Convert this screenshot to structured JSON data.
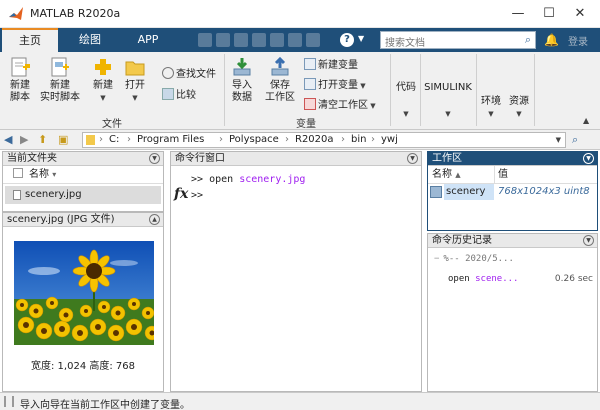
{
  "window": {
    "title": "MATLAB R2020a",
    "minimize": "—",
    "maximize": "☐",
    "close": "✕"
  },
  "tabs": [
    {
      "label": "主页"
    },
    {
      "label": "绘图"
    },
    {
      "label": "APP"
    }
  ],
  "search": {
    "placeholder": "搜索文档",
    "login": "登录"
  },
  "ribbon": {
    "file": {
      "new_script": [
        "新建",
        "脚本"
      ],
      "new_live_script": [
        "新建",
        "实时脚本"
      ],
      "new": "新建",
      "open": "打开",
      "find_files": "查找文件",
      "compare": "比较",
      "group_label": "文件"
    },
    "variable": {
      "import_data": [
        "导入",
        "数据"
      ],
      "save_workspace": [
        "保存",
        "工作区"
      ],
      "new_variable": "新建变量",
      "open_variable": "打开变量",
      "clear_workspace": "清空工作区",
      "group_label": "变量"
    },
    "code": "代码",
    "simulink": "SIMULINK",
    "environment": "环境",
    "resources": "资源"
  },
  "address": {
    "path": [
      "C:",
      "Program Files",
      "Polyspace",
      "R2020a",
      "bin",
      "ywj"
    ],
    "separator": "›"
  },
  "current_folder": {
    "title": "当前文件夹",
    "column_name": "名称",
    "sort_glyph": "▾",
    "files": [
      {
        "name": "scenery.jpg",
        "selected": true
      }
    ]
  },
  "details": {
    "title": "scenery.jpg  (JPG 文件)",
    "caption": "宽度: 1,024 高度: 768"
  },
  "command_window": {
    "title": "命令行窗口",
    "prompt": ">>",
    "command": "open",
    "argument": "scenery.jpg",
    "fx": "fx"
  },
  "workspace": {
    "title": "工作区",
    "col_name": "名称",
    "col_name_sort": "▲",
    "col_value": "值",
    "rows": [
      {
        "name": "scenery",
        "value": "768x1024x3 uint8"
      }
    ]
  },
  "history": {
    "title": "命令历史记录",
    "section": "%-- 2020/5...",
    "entries": [
      {
        "cmd": "open",
        "arg": "scene...",
        "time": "0.26 sec"
      }
    ]
  },
  "status": {
    "text": "导入向导在当前工作区中创建了变量。"
  },
  "colors": {
    "ribbon_blue": "#1f4f79",
    "accent_orange": "#e98b24",
    "selection_blue": "#cfe3f7"
  }
}
